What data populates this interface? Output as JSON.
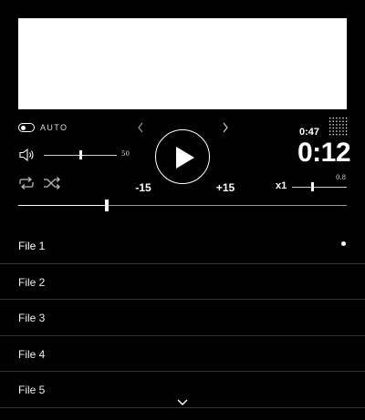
{
  "player": {
    "auto_label": "AUTO",
    "volume_value": "50",
    "volume_level": 0.5,
    "skip_back_label": "-15",
    "skip_forward_label": "+15",
    "time_total": "0:47",
    "time_current": "0:12",
    "speed_label": "x1",
    "speed_value": "0.8",
    "speed_level": 0.38,
    "progress": 0.27
  },
  "playlist": {
    "items": [
      {
        "name": "File 1",
        "active": true
      },
      {
        "name": "File 2",
        "active": false
      },
      {
        "name": "File 3",
        "active": false
      },
      {
        "name": "File 4",
        "active": false
      },
      {
        "name": "File 5",
        "active": false
      }
    ]
  },
  "icons": {
    "toggle": "toggle-icon",
    "prev": "chevron-left-icon",
    "next": "chevron-right-icon",
    "volume": "speaker-icon",
    "repeat": "repeat-icon",
    "shuffle": "shuffle-icon",
    "play": "play-icon",
    "grid": "dot-grid-icon",
    "more": "chevron-down-icon"
  }
}
